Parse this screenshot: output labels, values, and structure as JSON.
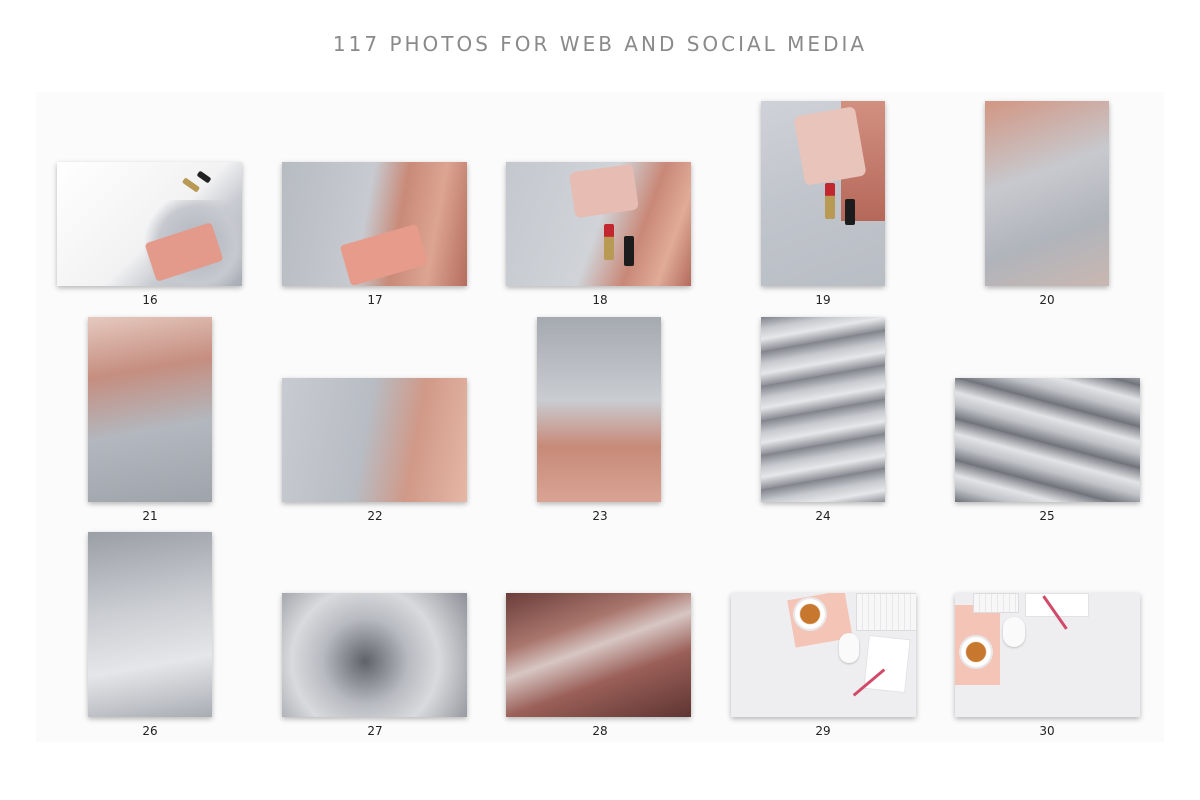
{
  "header": {
    "title": "117 PHOTOS FOR WEB AND SOCIAL MEDIA"
  },
  "photos": [
    {
      "number": "16",
      "subject": "pink-clutch-on-white-and-grey-tulle"
    },
    {
      "number": "17",
      "subject": "pink-clutch-on-grey-tulle-and-rose-sequins"
    },
    {
      "number": "18",
      "subject": "lipsticks-and-pink-pouch-on-tulle"
    },
    {
      "number": "19",
      "subject": "pink-pouch-and-lipsticks-portrait"
    },
    {
      "number": "20",
      "subject": "rose-sequins-and-grey-tulle-portrait"
    },
    {
      "number": "21",
      "subject": "blurred-tulle-and-rose-sequins"
    },
    {
      "number": "22",
      "subject": "grey-tulle-and-rose-sequins"
    },
    {
      "number": "23",
      "subject": "grey-tulle-over-rose-sequins"
    },
    {
      "number": "24",
      "subject": "grey-ruffled-tulle"
    },
    {
      "number": "25",
      "subject": "grey-ruffled-tulle-landscape"
    },
    {
      "number": "26",
      "subject": "soft-grey-tulle-ruffles"
    },
    {
      "number": "27",
      "subject": "grey-tulle-rosette"
    },
    {
      "number": "28",
      "subject": "rose-gold-sequin-fabric"
    },
    {
      "number": "29",
      "subject": "desk-flatlay-with-tea-and-keyboard"
    },
    {
      "number": "30",
      "subject": "desk-flatlay-with-tea-and-notebook"
    }
  ],
  "colors": {
    "title": "#8a8a8a",
    "panel": "#fbfbfb",
    "blush": "#e9a494",
    "tulle_grey": "#bfc2c8",
    "tea_orange": "#c8782e"
  }
}
